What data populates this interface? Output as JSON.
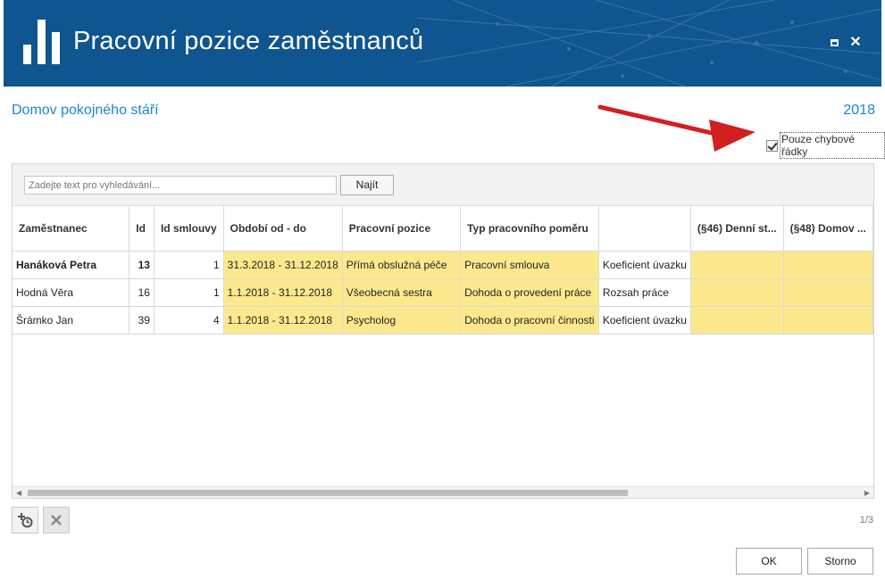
{
  "header": {
    "title": "Pracovní pozice zaměstnanců",
    "logo_icon": "bar-chart-icon",
    "maximize_icon": "maximize-icon",
    "close_icon": "close-icon",
    "background": "#0f5590"
  },
  "subheader": {
    "organization": "Domov pokojného stáří",
    "year": "2018",
    "accent_color": "#1c87c9"
  },
  "filter": {
    "only_error_rows_label": "Pouze chybové řádky",
    "only_error_rows_checked": true
  },
  "search": {
    "placeholder": "Zadejte text pro vyhledávání...",
    "button_label": "Najít"
  },
  "table": {
    "columns": [
      "Zaměstnanec",
      "Id",
      "Id smlouvy",
      "Období od - do",
      "Pracovní pozice",
      "Typ pracovního poměru",
      "",
      "(§46) Denní st...",
      "(§48) Domov ..."
    ],
    "rows": [
      {
        "employee": "Hanáková Petra",
        "id": "13",
        "contract_id": "1",
        "period": "31.3.2018 - 31.12.2018",
        "position": "Přímá obslužná péče",
        "employment_type": "Pracovní smlouva",
        "measure": "Koeficient úvazku",
        "c46": "",
        "c48": ""
      },
      {
        "employee": "Hodná Věra",
        "id": "16",
        "contract_id": "1",
        "period": "1.1.2018 - 31.12.2018",
        "position": "Všeobecná sestra",
        "employment_type": "Dohoda o provedení práce",
        "measure": "Rozsah práce",
        "c46": "",
        "c48": ""
      },
      {
        "employee": "Šrámko Jan",
        "id": "39",
        "contract_id": "4",
        "period": "1.1.2018 - 31.12.2018",
        "position": "Psycholog",
        "employment_type": "Dohoda o pracovní činnosti",
        "measure": "Koeficient úvazku",
        "c46": "",
        "c48": ""
      }
    ],
    "highlight_color": "#fde98d"
  },
  "toolbar": {
    "add_icon": "add-schedule-icon",
    "delete_icon": "delete-icon"
  },
  "pager": {
    "text": "1/3"
  },
  "dialog": {
    "ok_label": "OK",
    "cancel_label": "Storno"
  }
}
